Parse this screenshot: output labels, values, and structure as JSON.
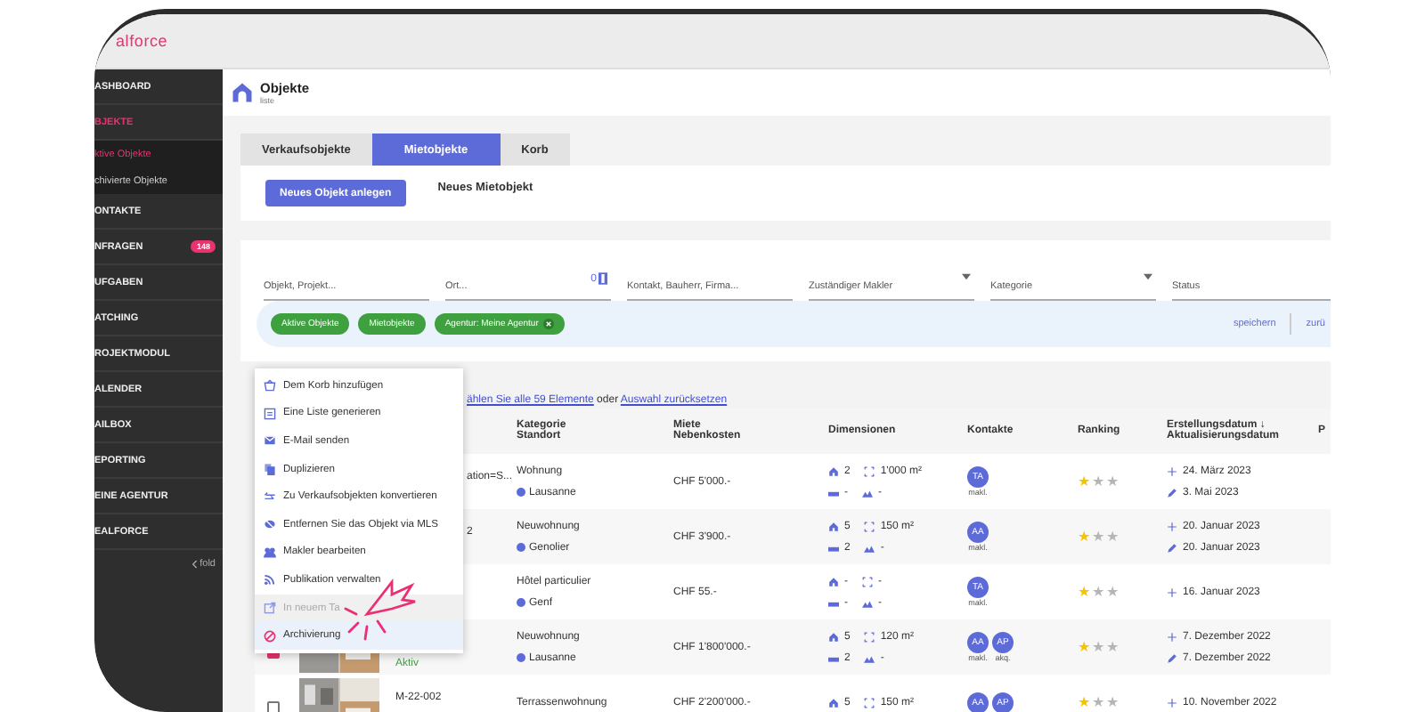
{
  "logo": "alforce",
  "sidebar": {
    "items": [
      {
        "label": "ASHBOARD",
        "selected": false
      },
      {
        "label": "BJEKTE",
        "selected": true,
        "children": [
          {
            "label": "ktive Objekte",
            "selected": true
          },
          {
            "label": "chivierte Objekte",
            "selected": false
          }
        ]
      },
      {
        "label": "ONTAKTE",
        "selected": false
      },
      {
        "label": "NFRAGEN",
        "selected": false,
        "badge": "148"
      },
      {
        "label": "UFGABEN",
        "selected": false
      },
      {
        "label": "ATCHING",
        "selected": false
      },
      {
        "label": "ROJEKTMODUL",
        "selected": false
      },
      {
        "label": "ALENDER",
        "selected": false
      },
      {
        "label": "AILBOX",
        "selected": false
      },
      {
        "label": "EPORTING",
        "selected": false
      },
      {
        "label": "EINE AGENTUR",
        "selected": false
      },
      {
        "label": "EALFORCE",
        "selected": false
      }
    ],
    "fold": "fold"
  },
  "page": {
    "title": "Objekte",
    "subtitle": "liste"
  },
  "tabs": [
    {
      "label": "Verkaufsobjekte",
      "selected": false
    },
    {
      "label": "Mietobjekte",
      "selected": true
    },
    {
      "label": "Korb",
      "selected": false
    }
  ],
  "new_button": "Neues Objekt anlegen",
  "new_label": "Neues Mietobjekt",
  "filters": [
    {
      "placeholder": "Objekt, Projekt...",
      "kind": "text"
    },
    {
      "placeholder": "Ort...",
      "kind": "count",
      "count": "0"
    },
    {
      "placeholder": "Kontakt, Bauherr, Firma...",
      "kind": "text"
    },
    {
      "placeholder": "Zuständiger Makler",
      "kind": "select"
    },
    {
      "placeholder": "Kategorie",
      "kind": "select"
    },
    {
      "placeholder": "Status",
      "kind": "text"
    }
  ],
  "chips": [
    {
      "label": "Aktive Objekte",
      "removable": false
    },
    {
      "label": "Mietobjekte",
      "removable": false
    },
    {
      "label": "Agentur: Meine Agentur",
      "removable": true
    }
  ],
  "chip_actions": [
    "speichern",
    "zurü"
  ],
  "select_all": {
    "link1": "ählen Sie alle 59 Elemente",
    "middle": "oder",
    "link2": "Auswahl zurücksetzen"
  },
  "menu": [
    {
      "label": "Dem Korb hinzufügen",
      "kind": "basket",
      "selected": false,
      "disabled": false
    },
    {
      "label": "Eine Liste generieren",
      "kind": "list",
      "selected": false,
      "disabled": false
    },
    {
      "label": "E-Mail senden",
      "kind": "mail",
      "selected": false,
      "disabled": false
    },
    {
      "label": "Duplizieren",
      "kind": "copy",
      "selected": false,
      "disabled": false
    },
    {
      "label": "Zu Verkaufsobjekten konvertieren",
      "kind": "convert",
      "selected": false,
      "disabled": false
    },
    {
      "label": "Entfernen Sie das Objekt via MLS",
      "kind": "mls",
      "selected": false,
      "disabled": false
    },
    {
      "label": "Makler bearbeiten",
      "kind": "people",
      "selected": false,
      "disabled": false
    },
    {
      "label": "Publikation verwalten",
      "kind": "rss",
      "selected": false,
      "disabled": false
    },
    {
      "label": "In neuem Ta",
      "kind": "newtab",
      "selected": false,
      "disabled": true
    },
    {
      "label": "Archivierung",
      "kind": "archive",
      "selected": true,
      "disabled": false
    }
  ],
  "table": {
    "columns": [
      [
        "Kategorie",
        "Standort"
      ],
      [
        "Miete",
        "Nebenkosten"
      ],
      [
        "Dimensionen"
      ],
      [
        "Kontakte"
      ],
      [
        "Ranking"
      ],
      [
        "Erstellungsdatum ↓",
        "Aktualisierungsdatum"
      ],
      [
        "P"
      ]
    ],
    "rows": [
      {
        "ref": "ation=S...",
        "partly_hidden": true,
        "kategorie": "Wohnung",
        "standort": "Lausanne",
        "miete": "CHF 5'000.-",
        "rooms": "2",
        "area": "1'000 m²",
        "beds": "-",
        "land": "-",
        "contacts": [
          {
            "initials": "TA",
            "role": "makl."
          }
        ],
        "stars": 1,
        "created": "24. März 2023",
        "updated": "3. Mai 2023"
      },
      {
        "ref": "2",
        "partly_hidden": true,
        "kategorie": "Neuwohnung",
        "standort": "Genolier",
        "miete": "CHF 3'900.-",
        "rooms": "5",
        "area": "150 m²",
        "beds": "2",
        "land": "-",
        "contacts": [
          {
            "initials": "AA",
            "role": "makl."
          }
        ],
        "stars": 1,
        "created": "20. Januar 2023",
        "updated": "20. Januar 2023"
      },
      {
        "kategorie": "Hôtel particulier",
        "standort": "Genf",
        "miete": "CHF 55.-",
        "rooms": "-",
        "area": "-",
        "beds": "-",
        "land": "-",
        "contacts": [
          {
            "initials": "TA",
            "role": "makl."
          }
        ],
        "stars": 1,
        "created": "16. Januar 2023"
      },
      {
        "checked": true,
        "photo": true,
        "status": "Aktiv",
        "kategorie": "Neuwohnung",
        "standort": "Lausanne",
        "miete": "CHF 1'800'000.-",
        "rooms": "5",
        "area": "120 m²",
        "beds": "2",
        "land": "-",
        "contacts": [
          {
            "initials": "AA",
            "role": "makl."
          },
          {
            "initials": "AP",
            "role": "akq."
          }
        ],
        "stars": 1,
        "created": "7. Dezember 2022",
        "updated": "7. Dezember 2022"
      },
      {
        "checked": false,
        "photo": true,
        "ref": "M-22-002",
        "kategorie": "Terrassenwohnung",
        "miete": "CHF 2'200'000.-",
        "rooms": "5",
        "area": "150 m²",
        "contacts": [
          {
            "initials": "AA"
          },
          {
            "initials": "AP"
          }
        ],
        "stars": 1,
        "created": "10. November 2022"
      }
    ]
  }
}
